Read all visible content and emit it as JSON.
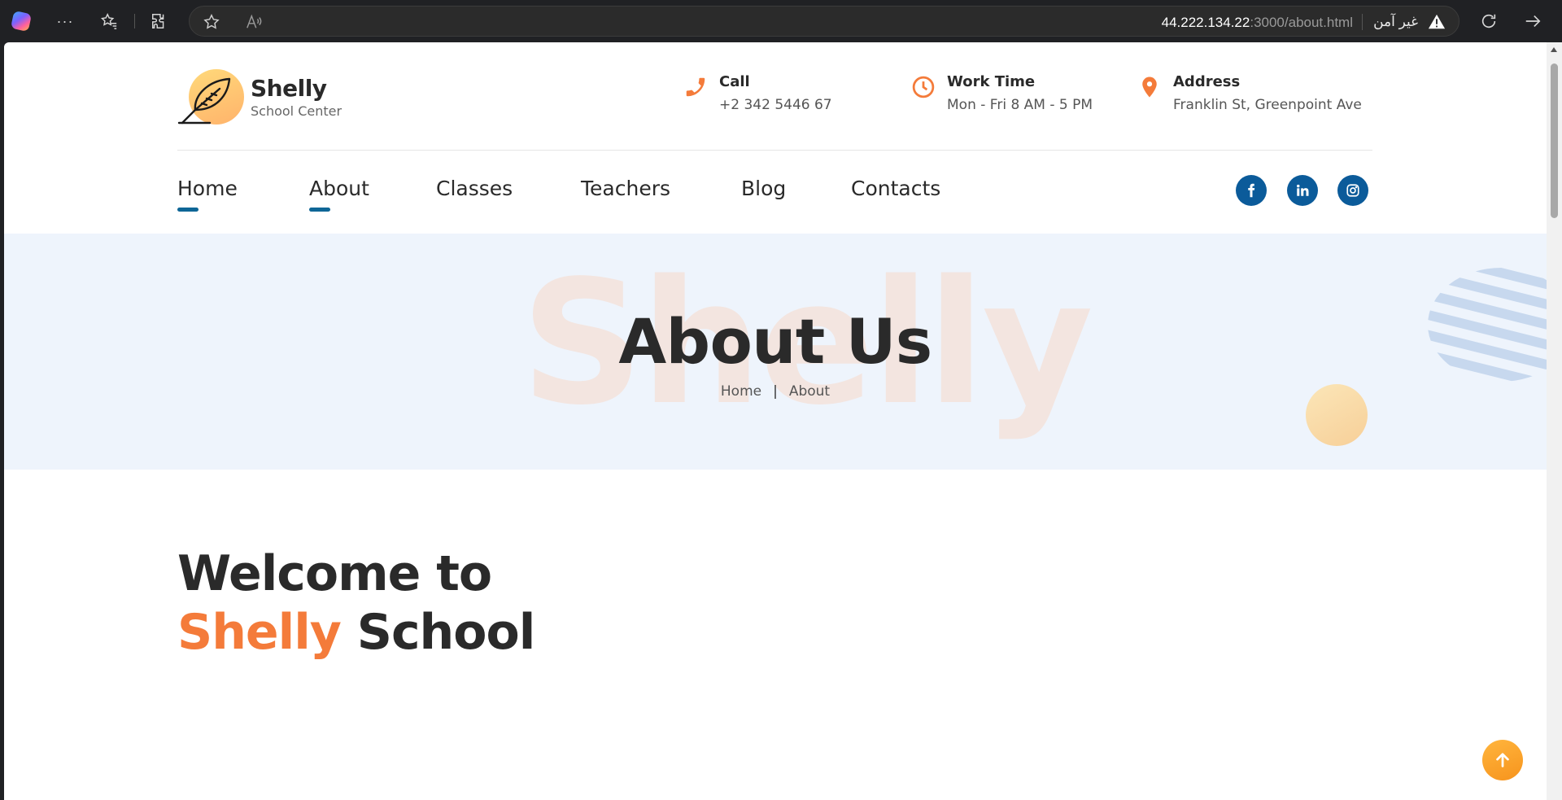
{
  "browser": {
    "url_host": "44.222.134.22",
    "url_path": ":3000/about.html",
    "security_label": "غير آمن"
  },
  "header": {
    "logo_title": "Shelly",
    "logo_subtitle": "School Center",
    "call": {
      "label": "Call",
      "value": "+2 342 5446 67",
      "icon": "phone-icon"
    },
    "work_time": {
      "label": "Work Time",
      "value": "Mon - Fri 8 AM - 5 PM",
      "icon": "clock-icon"
    },
    "address": {
      "label": "Address",
      "value": "Franklin St, Greenpoint Ave",
      "icon": "map-pin-icon"
    }
  },
  "nav": {
    "items": [
      "Home",
      "About",
      "Classes",
      "Teachers",
      "Blog",
      "Contacts"
    ],
    "active": [
      "Home",
      "About"
    ]
  },
  "social": [
    "facebook-icon",
    "linkedin-icon",
    "instagram-icon"
  ],
  "hero": {
    "background_word": "Shelly",
    "title": "About Us",
    "breadcrumb": {
      "home": "Home",
      "separator": "|",
      "current": "About"
    }
  },
  "welcome": {
    "line1": "Welcome to",
    "highlight": "Shelly",
    "rest": "School"
  },
  "colors": {
    "accent_orange": "#f47b3a",
    "accent_blue": "#0b5b9a",
    "hero_bg": "#eef4fc"
  }
}
